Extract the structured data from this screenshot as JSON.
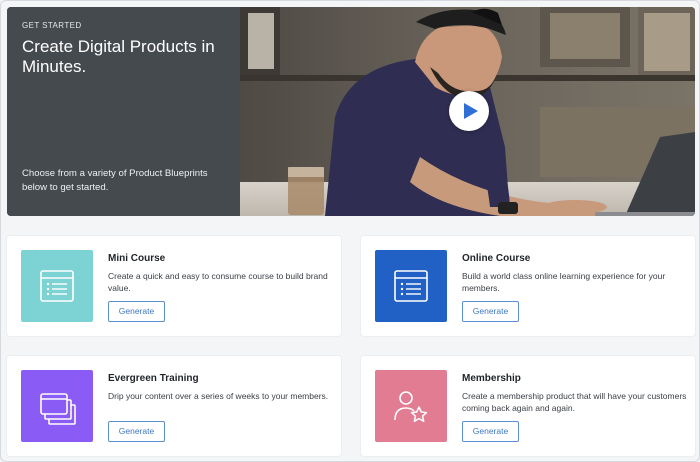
{
  "hero": {
    "eyebrow": "GET STARTED",
    "title": "Create Digital Products in Minutes.",
    "description": "Choose from a variety of Product Blueprints below to get started."
  },
  "cards": [
    {
      "title": "Mini Course",
      "description": "Create a quick and easy to consume course to build brand value.",
      "button": "Generate",
      "color": "#7dd3d3",
      "icon": "list-icon"
    },
    {
      "title": "Online Course",
      "description": "Build a world class online learning experience for your members.",
      "button": "Generate",
      "color": "#2160c4",
      "icon": "list-icon"
    },
    {
      "title": "Evergreen Training",
      "description": "Drip your content over a series of weeks to your members.",
      "button": "Generate",
      "color": "#8a5cf5",
      "icon": "stacked-cards-icon"
    },
    {
      "title": "Membership",
      "description": "Create a membership product that will have your customers coming back again and again.",
      "button": "Generate",
      "color": "#e27c93",
      "icon": "member-star-icon"
    }
  ],
  "colors": {
    "accent": "#3d78c9",
    "hero_panel": "#454a4f",
    "page_background": "#f4f5f7"
  }
}
